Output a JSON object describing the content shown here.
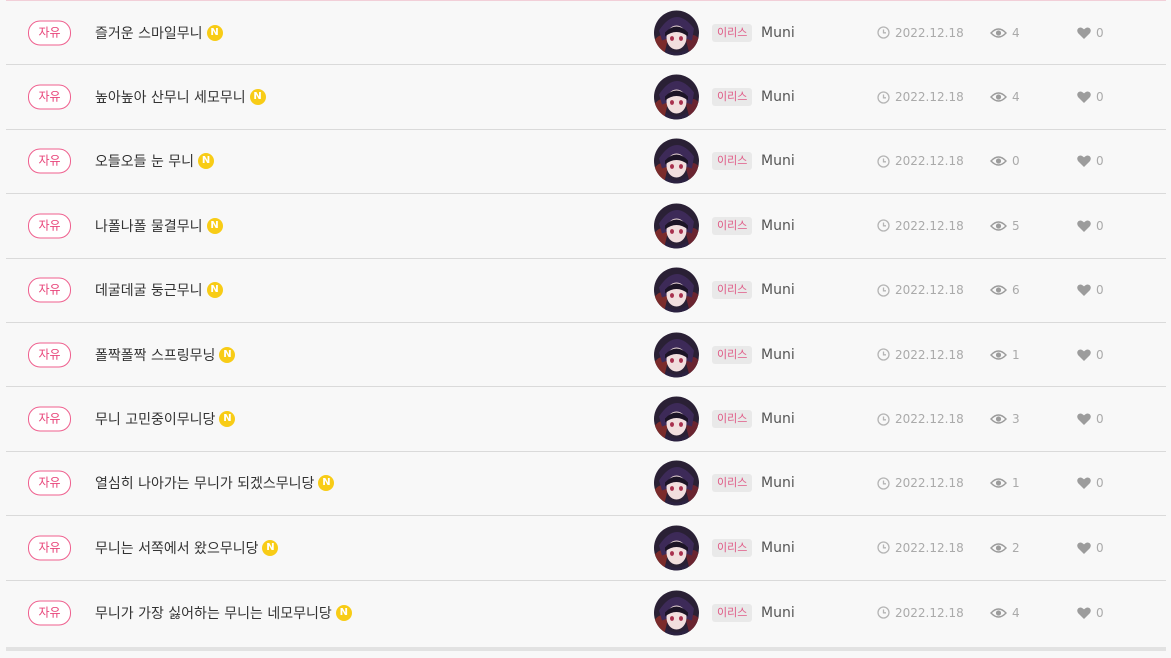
{
  "posts": [
    {
      "category": "자유",
      "title": "즐거운 스마일무니",
      "new_badge": "N",
      "server": "이리스",
      "author": "Muni",
      "date": "2022.12.18",
      "views": "4",
      "likes": "0"
    },
    {
      "category": "자유",
      "title": "높아높아 산무니 세모무니",
      "new_badge": "N",
      "server": "이리스",
      "author": "Muni",
      "date": "2022.12.18",
      "views": "4",
      "likes": "0"
    },
    {
      "category": "자유",
      "title": "오들오들 눈 무니",
      "new_badge": "N",
      "server": "이리스",
      "author": "Muni",
      "date": "2022.12.18",
      "views": "0",
      "likes": "0"
    },
    {
      "category": "자유",
      "title": "나폴나폴 물결무니",
      "new_badge": "N",
      "server": "이리스",
      "author": "Muni",
      "date": "2022.12.18",
      "views": "5",
      "likes": "0"
    },
    {
      "category": "자유",
      "title": "데굴데굴 둥근무니",
      "new_badge": "N",
      "server": "이리스",
      "author": "Muni",
      "date": "2022.12.18",
      "views": "6",
      "likes": "0"
    },
    {
      "category": "자유",
      "title": "폴짝폴짝 스프링무닝",
      "new_badge": "N",
      "server": "이리스",
      "author": "Muni",
      "date": "2022.12.18",
      "views": "1",
      "likes": "0"
    },
    {
      "category": "자유",
      "title": "무니 고민중이무니당",
      "new_badge": "N",
      "server": "이리스",
      "author": "Muni",
      "date": "2022.12.18",
      "views": "3",
      "likes": "0"
    },
    {
      "category": "자유",
      "title": "열심히 나아가는 무니가 되겠스무니당",
      "new_badge": "N",
      "server": "이리스",
      "author": "Muni",
      "date": "2022.12.18",
      "views": "1",
      "likes": "0"
    },
    {
      "category": "자유",
      "title": "무니는 서쪽에서 왔으무니당",
      "new_badge": "N",
      "server": "이리스",
      "author": "Muni",
      "date": "2022.12.18",
      "views": "2",
      "likes": "0"
    },
    {
      "category": "자유",
      "title": "무니가 가장 싫어하는 무니는 네모무니당",
      "new_badge": "N",
      "server": "이리스",
      "author": "Muni",
      "date": "2022.12.18",
      "views": "4",
      "likes": "0"
    }
  ],
  "icons": {
    "new": "new-badge-icon",
    "date": "clock-icon",
    "views": "eye-icon",
    "likes": "heart-icon"
  },
  "colors": {
    "accent": "#e8457a",
    "new_badge": "#f8cc16",
    "meta_text": "#aaaaaa"
  }
}
